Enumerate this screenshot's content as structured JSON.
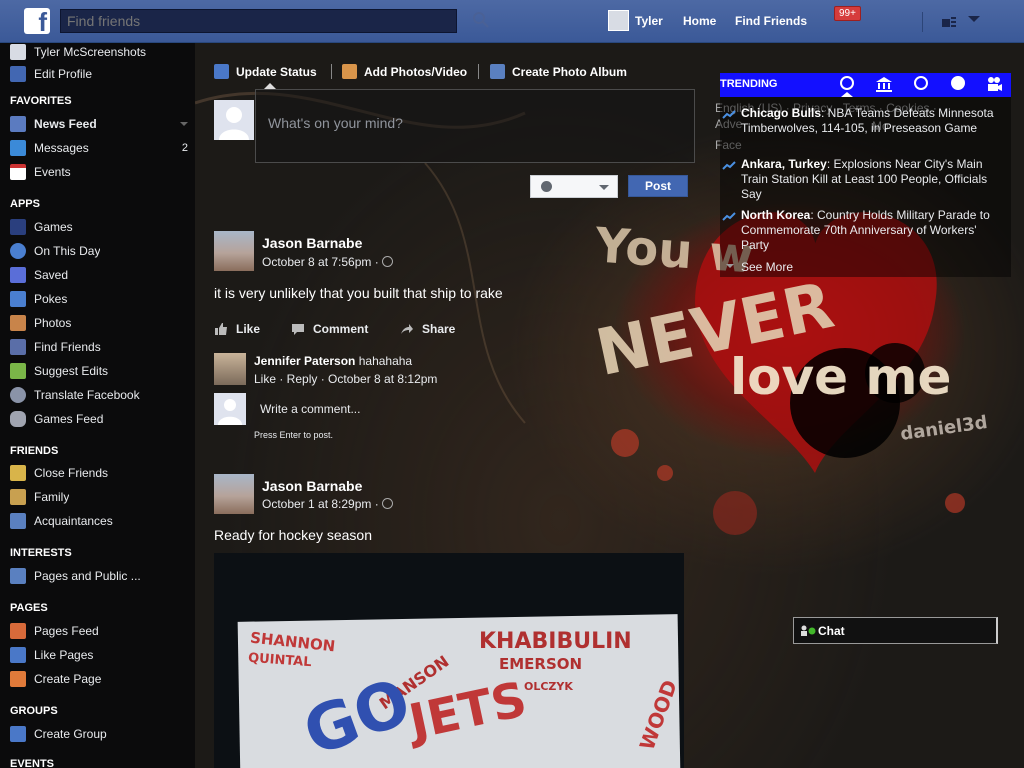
{
  "topbar": {
    "logo_letter": "f",
    "search_placeholder": "Find friends",
    "user_name": "Tyler",
    "home_label": "Home",
    "find_friends_label": "Find Friends",
    "notification_count": "99+"
  },
  "sidebar": {
    "profile_name": "Tyler McScreenshots",
    "edit_profile": "Edit Profile",
    "favorites_heading": "FAVORITES",
    "favorites": [
      {
        "label": "News Feed",
        "count": ""
      },
      {
        "label": "Messages",
        "count": "2"
      },
      {
        "label": "Events",
        "count": ""
      }
    ],
    "apps_heading": "APPS",
    "apps": [
      "Games",
      "On This Day",
      "Saved",
      "Pokes",
      "Photos",
      "Find Friends",
      "Suggest Edits",
      "Translate Facebook",
      "Games Feed"
    ],
    "friends_heading": "FRIENDS",
    "friends": [
      "Close Friends",
      "Family",
      "Acquaintances"
    ],
    "interests_heading": "INTERESTS",
    "interests": [
      "Pages and Public ..."
    ],
    "pages_heading": "PAGES",
    "pages": [
      "Pages Feed",
      "Like Pages",
      "Create Page"
    ],
    "groups_heading": "GROUPS",
    "groups": [
      "Create Group"
    ],
    "events_heading": "EVENTS"
  },
  "composer": {
    "tab_status": "Update Status",
    "tab_photos": "Add Photos/Video",
    "tab_album": "Create Photo Album",
    "placeholder": "What's on your mind?",
    "post_label": "Post"
  },
  "posts": [
    {
      "author": "Jason Barnabe",
      "time": "October 8 at 7:56pm ·",
      "text": "it is very unlikely that you built that ship to rake",
      "like": "Like",
      "comment": "Comment",
      "share": "Share",
      "comment_author": "Jennifer Paterson",
      "comment_text": "hahahaha",
      "comment_meta": "Like · Reply · October 8 at 8:12pm",
      "write_comment": "Write a comment...",
      "press_enter": "Press Enter to post."
    },
    {
      "author": "Jason Barnabe",
      "time": "October 1 at 8:29pm ·",
      "text": "Ready for hockey season"
    }
  ],
  "trending": {
    "label": "TRENDING",
    "items": [
      {
        "topic": "Chicago Bulls",
        "desc": ": NBA Teams Defeats Minnesota Timberwolves, 114-105, in Preseason Game"
      },
      {
        "topic": "Ankara, Turkey",
        "desc": ": Explosions Near City's Main Train Station Kill at Least 100 People, Officials Say"
      },
      {
        "topic": "North Korea",
        "desc": ": Country Holds Military Parade to Commemorate 70th Anniversary of Workers' Party"
      }
    ],
    "see_more": "See More"
  },
  "footer_ghost": {
    "line1": "English (US) · Privacy · Terms · Cookies ·",
    "line2": "Adve",
    "line2b": "Mo",
    "line3": "Face"
  },
  "wallpaper": {
    "line1": "You w",
    "line2": "NEVER",
    "line3": "love me",
    "signature": "daniel3d"
  },
  "photo_text": {
    "w1": "SHANNON",
    "w2": "QUINTAL",
    "w3": "KHABIBULIN",
    "w4": "EMERSON",
    "w5": "MANSON",
    "w6": "OLCZYK",
    "w7": "JETS",
    "w8": "GO",
    "w9": "WOOD"
  },
  "chat": {
    "label": "Chat"
  },
  "colors": {
    "topbar": "#3b5998",
    "trending_bar": "#1310ff",
    "post_button": "#4267b2",
    "badge": "#d63c3c"
  }
}
